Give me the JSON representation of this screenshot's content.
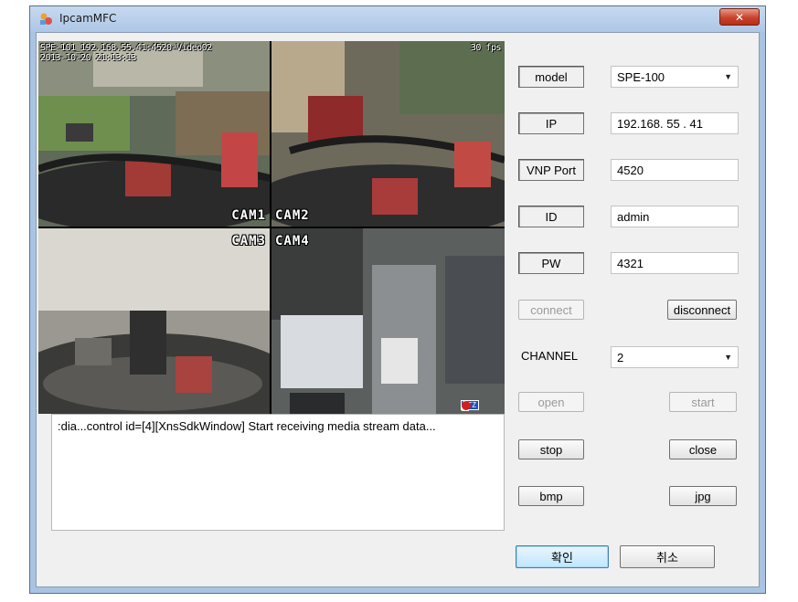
{
  "window": {
    "title": "IpcamMFC",
    "close_glyph": "✕"
  },
  "video": {
    "osd_line1": "SPE-101_192.168.55.41:4520-Video02",
    "osd_line2": "2013-10-20 21:13:13",
    "fps": "30 fps",
    "cams": [
      {
        "label": "CAM1"
      },
      {
        "label": "CAM2"
      },
      {
        "label": "CAM3"
      },
      {
        "label": "CAM4"
      }
    ],
    "status_icons": [
      "ptz-icon",
      "lock-icon",
      "satellite-icon",
      "record-icon"
    ],
    "ptz_text": "PTZ"
  },
  "log": {
    "text": ":dia...control id=[4][XnsSdkWindow] Start receiving media stream data..."
  },
  "form": {
    "model_label": "model",
    "model_value": "SPE-100",
    "ip_label": "IP",
    "ip_value": "192.168. 55 . 41",
    "port_label": "VNP Port",
    "port_value": "4520",
    "id_label": "ID",
    "id_value": "admin",
    "pw_label": "PW",
    "pw_value": "4321",
    "channel_label": "CHANNEL",
    "channel_value": "2"
  },
  "buttons": {
    "connect": "connect",
    "disconnect": "disconnect",
    "open": "open",
    "start": "start",
    "stop": "stop",
    "close": "close",
    "bmp": "bmp",
    "jpg": "jpg",
    "ok": "확인",
    "cancel": "취소"
  },
  "colors": {
    "titlebar": "#aec7e6",
    "close_button": "#c8432a",
    "dialog_bg": "#f0f0f0",
    "ok_button_border": "#3c7fb1"
  }
}
